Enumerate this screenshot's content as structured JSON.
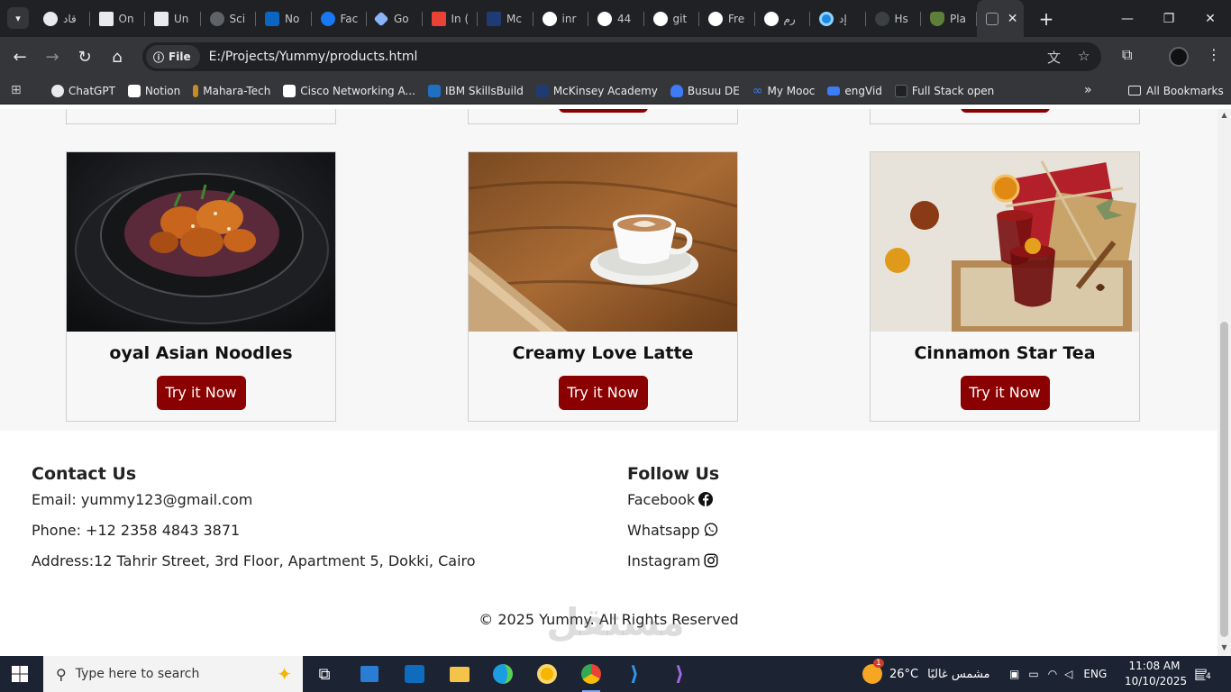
{
  "browser": {
    "tabs": [
      {
        "label": "قاد",
        "color": "#e8eaed"
      },
      {
        "label": "On",
        "color": "#e8eaed"
      },
      {
        "label": "Un",
        "color": "#e8eaed"
      },
      {
        "label": "Sci",
        "color": "#9aa0a6"
      },
      {
        "label": "No",
        "color": "#0a66c2"
      },
      {
        "label": "Fac",
        "color": "#1877f2"
      },
      {
        "label": "Go",
        "color": "#8ab4f8"
      },
      {
        "label": "In (",
        "color": "#ea4335"
      },
      {
        "label": "Mc",
        "color": "#1f3b73"
      },
      {
        "label": "inr",
        "color": "#ffffff"
      },
      {
        "label": "44",
        "color": "#ffffff"
      },
      {
        "label": "git",
        "color": "#ffffff"
      },
      {
        "label": "Fre",
        "color": "#ffffff"
      },
      {
        "label": "رم",
        "color": "#ffffff"
      },
      {
        "label": "إد",
        "color": "#1e88e5"
      },
      {
        "label": "Hs",
        "color": "#3c4043"
      },
      {
        "label": "Pla",
        "color": "#5e7f3a"
      }
    ],
    "active_tab_label": "",
    "address_chip": "File",
    "url": "E:/Projects/Yummy/products.html",
    "bookmarks": [
      {
        "label": "ChatGPT",
        "color": "#e8eaed"
      },
      {
        "label": "Notion",
        "color": "#ffffff"
      },
      {
        "label": "Mahara-Tech",
        "color": "#c58b2a"
      },
      {
        "label": "Cisco Networking A...",
        "color": "#ffffff"
      },
      {
        "label": "IBM SkillsBuild",
        "color": "#1f70c1"
      },
      {
        "label": "McKinsey Academy",
        "color": "#1f3b73"
      },
      {
        "label": "Busuu DE",
        "color": "#3d7bf7"
      },
      {
        "label": "My Mooc",
        "color": "#3d7bf7"
      },
      {
        "label": "engVid",
        "color": "#3d7bf7"
      },
      {
        "label": "Full Stack open",
        "color": "#202124"
      }
    ],
    "all_bookmarks": "All Bookmarks"
  },
  "page": {
    "cards": [
      {
        "title": "oyal Asian Noodles",
        "button": "Try it Now",
        "image": "asian-noodles-photo"
      },
      {
        "title": "Creamy Love Latte",
        "button": "Try it Now",
        "image": "latte-photo"
      },
      {
        "title": "Cinnamon Star Tea",
        "button": "Try it Now",
        "image": "cinnamon-tea-photo"
      }
    ],
    "footer": {
      "contact_heading": "Contact Us",
      "email": "Email: yummy123@gmail.com",
      "phone": "Phone: +12 2358 4843 3871",
      "address": "Address:12 Tahrir Street, 3rd Floor, Apartment 5, Dokki, Cairo",
      "follow_heading": "Follow Us",
      "facebook": "Facebook",
      "whatsapp": "Whatsapp",
      "instagram": "Instagram",
      "copyright": "© 2025 Yummy. All Rights Reserved"
    },
    "watermark": "مستقل"
  },
  "taskbar": {
    "search_placeholder": "Type here to search",
    "weather": "26°C",
    "weather_desc": "مشمس غالبًا",
    "weather_badge": "1",
    "language": "ENG",
    "time": "11:08 AM",
    "date": "10/10/2025",
    "notification_count": "4"
  },
  "colors": {
    "brand_button": "#8b0000",
    "chrome_dark": "#202124",
    "chrome_toolbar": "#35363a"
  }
}
